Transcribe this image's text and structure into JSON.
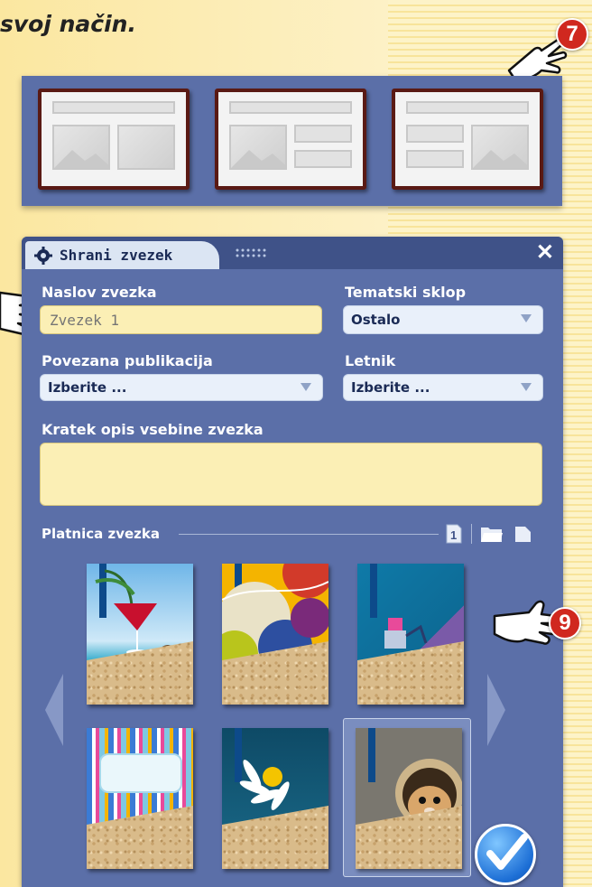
{
  "intro": {
    "text": "svoj način."
  },
  "callouts": {
    "seven": "7",
    "nine": "9"
  },
  "dialog": {
    "title": "Shrani zvezek",
    "close": "✕",
    "fields": {
      "naslov_label": "Naslov zvezka",
      "naslov_placeholder": "Zvezek 1",
      "tematski_label": "Tematski sklop",
      "tematski_value": "Ostalo",
      "povezana_label": "Povezana publikacija",
      "povezana_value": "Izberite ...",
      "letnik_label": "Letnik",
      "letnik_value": "Izberite ...",
      "opis_label": "Kratek opis vsebine zvezka"
    },
    "covers": {
      "section_label": "Platnica zvezka",
      "page_badge": "1",
      "items": [
        "tropical-cocktail",
        "yellow-abstract",
        "blue-robot",
        "striped-label",
        "daisy",
        "hamster"
      ],
      "selected_index": 5
    }
  },
  "colors": {
    "panel": "#5b6fa8",
    "header": "#3f5288",
    "accent_red": "#d0281f",
    "input_yellow": "#fbefb5"
  }
}
